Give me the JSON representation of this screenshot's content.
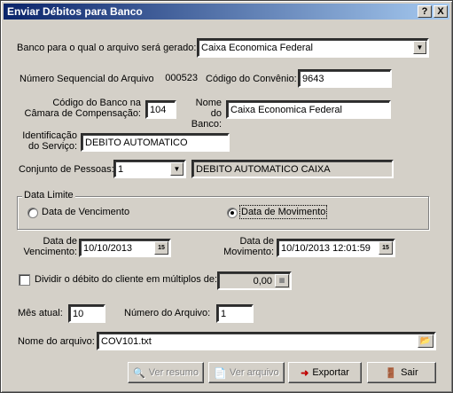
{
  "window": {
    "title": "Enviar Débitos para Banco",
    "help_btn": "?",
    "close_btn": "X"
  },
  "banco": {
    "label": "Banco para o qual o arquivo será gerado:",
    "value": "Caixa Economica Federal"
  },
  "sequencial": {
    "label": "Número Sequencial do Arquivo:",
    "value": "000523"
  },
  "convenio": {
    "label": "Código do Convênio:",
    "value": "9643"
  },
  "codigo_banco": {
    "label": "Código do Banco na Câmara de Compensação:",
    "value": "104"
  },
  "nome_banco": {
    "label": "Nome do Banco:",
    "value": "Caixa Economica Federal"
  },
  "servico": {
    "label": "Identificação do Serviço:",
    "value": "DEBITO AUTOMATICO"
  },
  "conjunto": {
    "label": "Conjunto de Pessoas:",
    "value": "1",
    "description": "DEBITO AUTOMATICO CAIXA"
  },
  "data_limite": {
    "legend": "Data Limite",
    "option_vencimento": "Data de Vencimento",
    "option_movimento": "Data de Movimento",
    "selected": "movimento"
  },
  "data_vencimento": {
    "label": "Data de Vencimento:",
    "value": "10/10/2013"
  },
  "data_movimento": {
    "label": "Data de Movimento:",
    "value": "10/10/2013 12:01:59"
  },
  "calendar_glyph": "15",
  "dividir": {
    "label": "Dividir o débito do cliente em múltiplos de:",
    "value": "0,00",
    "checked": false
  },
  "mes_atual": {
    "label": "Mês atual:",
    "value": "10"
  },
  "numero_arquivo": {
    "label": "Número do Arquivo:",
    "value": "1"
  },
  "nome_arquivo": {
    "label": "Nome do arquivo:",
    "value": "COV101.txt"
  },
  "buttons": {
    "ver_resumo": "Ver resumo",
    "ver_arquivo": "Ver arquivo",
    "exportar": "Exportar",
    "sair": "Sair"
  }
}
